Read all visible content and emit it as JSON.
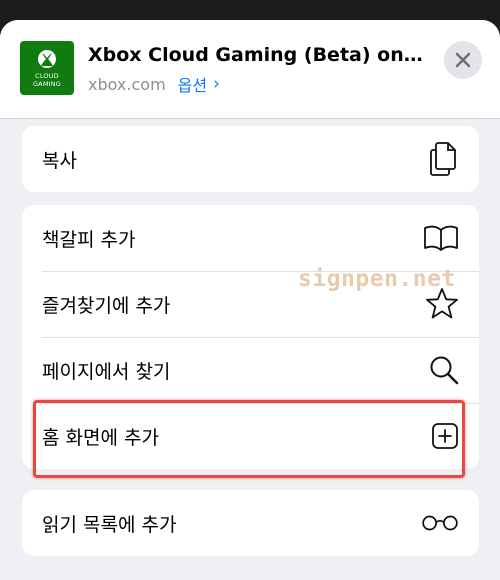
{
  "header": {
    "app_icon_text": "CLOUD\nGAMING",
    "title": "Xbox Cloud Gaming (Beta) on Xb...",
    "domain": "xbox.com",
    "options_label": "옵션",
    "options_chevron": "›"
  },
  "groups": [
    {
      "items": [
        {
          "label": "복사",
          "icon": "copy-icon"
        }
      ]
    },
    {
      "items": [
        {
          "label": "책갈피 추가",
          "icon": "book-icon"
        },
        {
          "label": "즐겨찾기에 추가",
          "icon": "star-icon"
        },
        {
          "label": "페이지에서 찾기",
          "icon": "search-icon"
        },
        {
          "label": "홈 화면에 추가",
          "icon": "add-square-icon"
        }
      ]
    },
    {
      "items": [
        {
          "label": "읽기 목록에 추가",
          "icon": "glasses-icon"
        }
      ]
    }
  ],
  "watermark": "signpen.net",
  "colors": {
    "accent": "#0a7aff",
    "xbox_green": "#107c10",
    "highlight": "#e8483f"
  }
}
